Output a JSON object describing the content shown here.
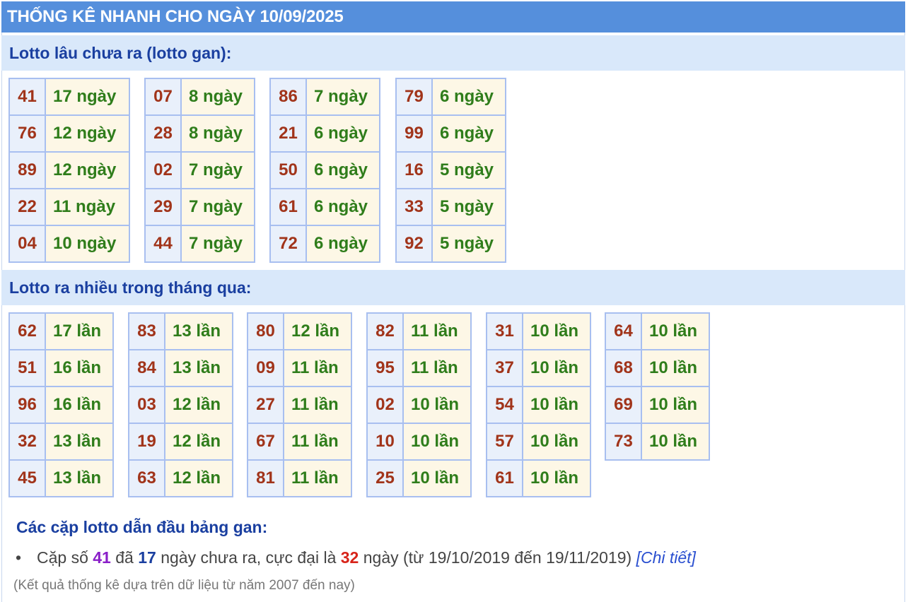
{
  "title": "THỐNG KÊ NHANH CHO NGÀY 10/09/2025",
  "gan_section": {
    "heading": "Lotto lâu chưa ra (lotto gan):",
    "groups": [
      [
        [
          "41",
          "17 ngày"
        ],
        [
          "76",
          "12 ngày"
        ],
        [
          "89",
          "12 ngày"
        ],
        [
          "22",
          "11 ngày"
        ],
        [
          "04",
          "10 ngày"
        ]
      ],
      [
        [
          "07",
          "8 ngày"
        ],
        [
          "28",
          "8 ngày"
        ],
        [
          "02",
          "7 ngày"
        ],
        [
          "29",
          "7 ngày"
        ],
        [
          "44",
          "7 ngày"
        ]
      ],
      [
        [
          "86",
          "7 ngày"
        ],
        [
          "21",
          "6 ngày"
        ],
        [
          "50",
          "6 ngày"
        ],
        [
          "61",
          "6 ngày"
        ],
        [
          "72",
          "6 ngày"
        ]
      ],
      [
        [
          "79",
          "6 ngày"
        ],
        [
          "99",
          "6 ngày"
        ],
        [
          "16",
          "5 ngày"
        ],
        [
          "33",
          "5 ngày"
        ],
        [
          "92",
          "5 ngày"
        ]
      ]
    ]
  },
  "freq_section": {
    "heading": "Lotto ra nhiều trong tháng qua:",
    "groups": [
      [
        [
          "62",
          "17 lần"
        ],
        [
          "51",
          "16 lần"
        ],
        [
          "96",
          "16 lần"
        ],
        [
          "32",
          "13 lần"
        ],
        [
          "45",
          "13 lần"
        ]
      ],
      [
        [
          "83",
          "13 lần"
        ],
        [
          "84",
          "13 lần"
        ],
        [
          "03",
          "12 lần"
        ],
        [
          "19",
          "12 lần"
        ],
        [
          "63",
          "12 lần"
        ]
      ],
      [
        [
          "80",
          "12 lần"
        ],
        [
          "09",
          "11 lần"
        ],
        [
          "27",
          "11 lần"
        ],
        [
          "67",
          "11 lần"
        ],
        [
          "81",
          "11 lần"
        ]
      ],
      [
        [
          "82",
          "11 lần"
        ],
        [
          "95",
          "11 lần"
        ],
        [
          "02",
          "10 lần"
        ],
        [
          "10",
          "10 lần"
        ],
        [
          "25",
          "10 lần"
        ]
      ],
      [
        [
          "31",
          "10 lần"
        ],
        [
          "37",
          "10 lần"
        ],
        [
          "54",
          "10 lần"
        ],
        [
          "57",
          "10 lần"
        ],
        [
          "61",
          "10 lần"
        ]
      ],
      [
        [
          "64",
          "10 lần"
        ],
        [
          "68",
          "10 lần"
        ],
        [
          "69",
          "10 lần"
        ],
        [
          "73",
          "10 lần"
        ]
      ]
    ]
  },
  "summary": {
    "title": "Các cặp lotto dẫn đầu bảng gan:",
    "bullet": "•",
    "part1": "Cặp số ",
    "number": "41",
    "part2": " đã ",
    "days": "17",
    "part3": " ngày chưa ra, cực đại là ",
    "max": "32",
    "part4": " ngày (từ 19/10/2019 đến 19/11/2019) ",
    "link": "[Chi tiết]"
  },
  "footnote": "(Kết quả thống kê dựa trên dữ liệu từ năm 2007 đến nay)",
  "colors": {
    "title_bg": "#558fdc",
    "header_bg": "#d9e8fa",
    "number": "#a1341a",
    "value": "#2f7d1b",
    "border": "#a8bff0"
  }
}
